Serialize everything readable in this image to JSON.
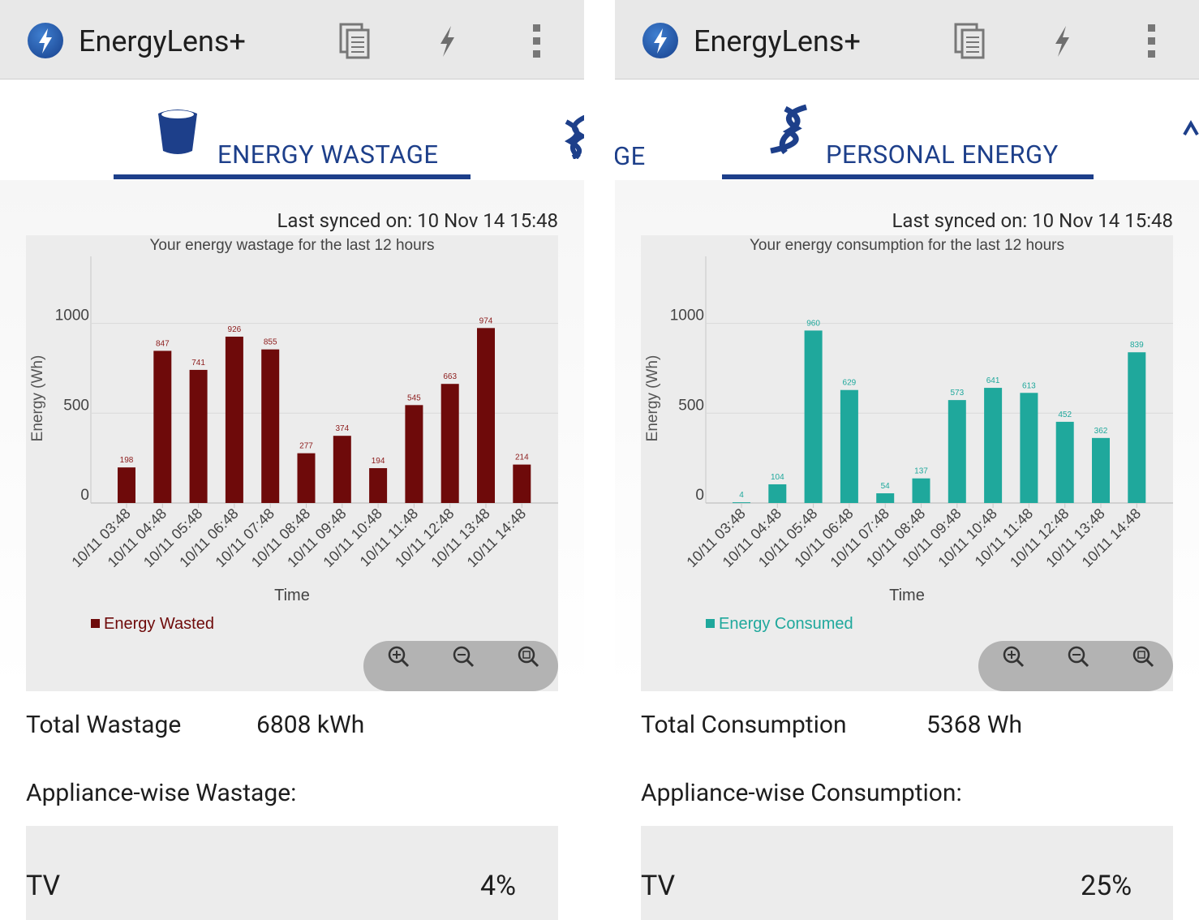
{
  "screens": [
    {
      "app_title": "EnergyLens+",
      "active_tab_label": "ENERGY WASTAGE",
      "prev_tab_peek": "",
      "next_tab_peek": "",
      "sync_text": "Last synced on: 10 Nov 14 15:48",
      "total_label": "Total Wastage",
      "total_value": "6808 kWh",
      "appliance_section_label": "Appliance-wise Wastage:",
      "appliance_rows": [
        {
          "name": "TV",
          "value": "4%"
        }
      ],
      "colors": {
        "bar": "#6e0a0a",
        "label": "#8c1b1b"
      },
      "icons": {
        "logo": "lightning-bolt-logo",
        "tab": "trash-bin-icon",
        "peek_right": "dna-helix-icon"
      }
    },
    {
      "app_title": "EnergyLens+",
      "active_tab_label": "PERSONAL ENERGY",
      "prev_tab_peek": "GE",
      "next_tab_peek": "",
      "sync_text": "Last synced on: 10 Nov 14 15:48",
      "total_label": "Total Consumption",
      "total_value": "5368 Wh",
      "appliance_section_label": "Appliance-wise Consumption:",
      "appliance_rows": [
        {
          "name": "TV",
          "value": "25%"
        }
      ],
      "colors": {
        "bar": "#1fa89c",
        "label": "#1fa89c"
      },
      "icons": {
        "logo": "lightning-bolt-logo",
        "tab": "dna-helix-icon",
        "peek_right": "chevron-icon"
      }
    }
  ],
  "chart_data": [
    {
      "type": "bar",
      "title": "Your energy wastage for the last 12 hours",
      "xlabel": "Time",
      "ylabel": "Energy (Wh)",
      "ylim": [
        0,
        1400
      ],
      "yticks": [
        "0",
        "500",
        "1000"
      ],
      "grid": true,
      "legend_position": "bottom-left",
      "categories": [
        "10/11 03:48",
        "10/11 04:48",
        "10/11 05:48",
        "10/11 06:48",
        "10/11 07:48",
        "10/11 08:48",
        "10/11 09:48",
        "10/11 10:48",
        "10/11 11:48",
        "10/11 12:48",
        "10/11 13:48",
        "10/11 14:48"
      ],
      "series": [
        {
          "name": "Energy Wasted",
          "color": "#6e0a0a",
          "values": [
            198,
            847,
            741,
            926,
            855,
            277,
            374,
            194,
            545,
            663,
            974,
            214
          ]
        }
      ]
    },
    {
      "type": "bar",
      "title": "Your energy consumption for the last 12 hours",
      "xlabel": "Time",
      "ylabel": "Energy (Wh)",
      "ylim": [
        0,
        1400
      ],
      "yticks": [
        "0",
        "500",
        "1000"
      ],
      "grid": true,
      "legend_position": "bottom-left",
      "categories": [
        "10/11 03:48",
        "10/11 04:48",
        "10/11 05:48",
        "10/11 06:48",
        "10/11 07:48",
        "10/11 08:48",
        "10/11 09:48",
        "10/11 10:48",
        "10/11 11:48",
        "10/11 12:48",
        "10/11 13:48",
        "10/11 14:48"
      ],
      "series": [
        {
          "name": "Energy Consumed",
          "color": "#1fa89c",
          "values": [
            4,
            104,
            960,
            629,
            54,
            137,
            573,
            641,
            613,
            452,
            362,
            839
          ]
        }
      ]
    }
  ]
}
